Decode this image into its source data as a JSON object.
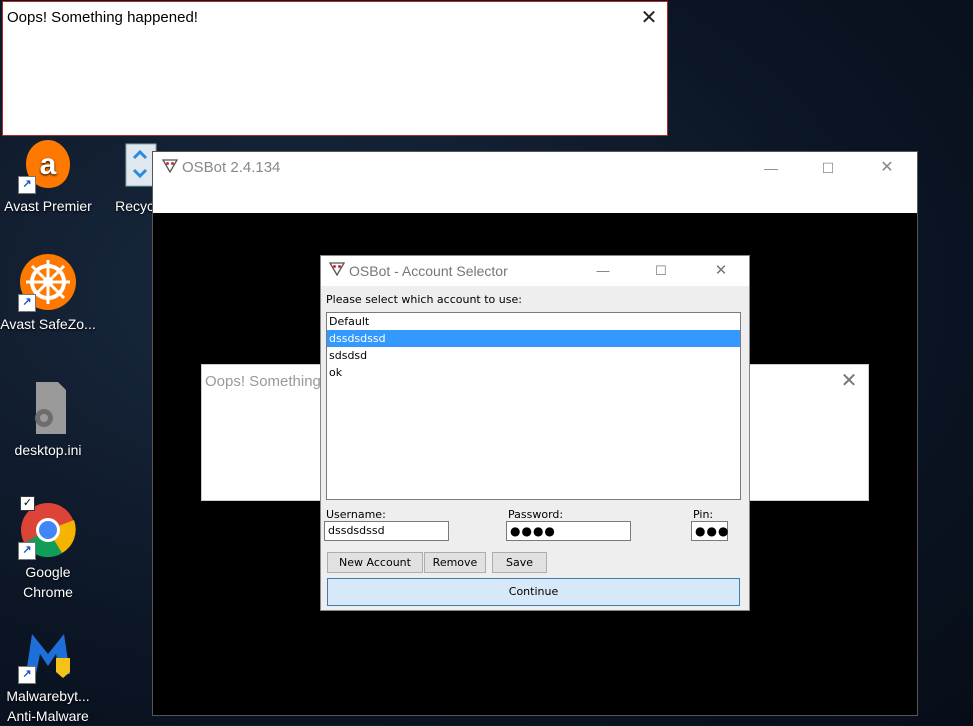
{
  "desktop": {
    "icons": [
      {
        "label": "Avast Premier"
      },
      {
        "label": "Recycle"
      },
      {
        "label": "Avast SafeZo..."
      },
      {
        "label": "desktop.ini"
      },
      {
        "label": "Google Chrome"
      },
      {
        "label": "Malwarebyt... Anti-Malware"
      }
    ]
  },
  "error_popup": {
    "message": "Oops! Something happened!",
    "close": "✕"
  },
  "osbot_window": {
    "title": "OSBot 2.4.134",
    "minimize": "—",
    "maximize": "☐",
    "close": "✕"
  },
  "background_error": {
    "message": "Oops! Something",
    "close": "✕"
  },
  "account_selector": {
    "title": "OSBot - Account Selector",
    "minimize": "—",
    "maximize": "☐",
    "close": "✕",
    "prompt": "Please select which account to use:",
    "accounts": [
      {
        "name": "Default",
        "selected": false
      },
      {
        "name": "dssdsdssd",
        "selected": true
      },
      {
        "name": "sdsdsd",
        "selected": false
      },
      {
        "name": "ok",
        "selected": false
      }
    ],
    "username_label": "Username:",
    "username_value": "dssdsdssd",
    "password_label": "Password:",
    "password_value": "●●●●",
    "pin_label": "Pin:",
    "pin_value": "●●●",
    "new_account_label": "New Account",
    "remove_label": "Remove",
    "save_label": "Save",
    "continue_label": "Continue"
  },
  "colors": {
    "selection": "#3399ff",
    "error_border": "#b02a2a",
    "continue_bg": "#d7e9f8"
  }
}
